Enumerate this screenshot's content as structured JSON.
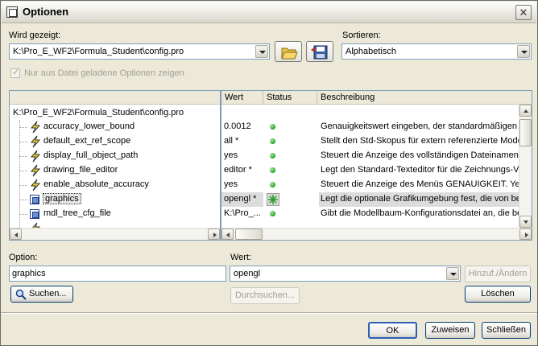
{
  "window": {
    "title": "Optionen",
    "close_glyph": "✕"
  },
  "top": {
    "shown_label": "Wird gezeigt:",
    "shown_value": "K:\\Pro_E_WF2\\Formula_Student\\config.pro",
    "sort_label": "Sortieren:",
    "sort_value": "Alphabetisch",
    "checkbox_label": "Nur aus Datei geladene Optionen zeigen"
  },
  "table": {
    "columns": {
      "wert": "Wert",
      "status": "Status",
      "beschreibung": "Beschreibung"
    },
    "root": "K:\\Pro_E_WF2\\Formula_Student\\config.pro",
    "rows": [
      {
        "name": "accuracy_lower_bound",
        "icon": "bolt-icon",
        "wert": "0.0012",
        "desc": "Genauigkeitswert eingeben, der standardmäßigen untere"
      },
      {
        "name": "default_ext_ref_scope",
        "icon": "bolt-icon",
        "wert": "all *",
        "desc": "Stellt den Std-Skopus für extern referenzierte Modelle"
      },
      {
        "name": "display_full_object_path",
        "icon": "bolt-icon",
        "wert": "yes",
        "desc": "Steuert die Anzeige des vollständigen Dateinamens"
      },
      {
        "name": "drawing_file_editor",
        "icon": "bolt-icon",
        "wert": "editor *",
        "desc": "Legt den Standard-Texteditor für die Zeichnungs-Vorlage"
      },
      {
        "name": "enable_absolute_accuracy",
        "icon": "bolt-icon",
        "wert": "yes",
        "desc": "Steuert die Anzeige des Menüs GENAUIGKEIT. Yes"
      },
      {
        "name": "graphics",
        "icon": "box-icon",
        "wert": "opengl *",
        "desc": "Legt die optionale Grafikumgebung fest, die von bes"
      },
      {
        "name": "mdl_tree_cfg_file",
        "icon": "box-icon",
        "wert": "K:\\Pro_...",
        "desc": "Gibt die Modellbaum-Konfigurationsdatei an, die beim"
      }
    ]
  },
  "bottom": {
    "option_label": "Option:",
    "option_value": "graphics",
    "wert_label": "Wert:",
    "wert_value": "opengl",
    "add_change": "Hinzuf./Ändern",
    "search": "Suchen...",
    "browse": "Durchsuchen...",
    "delete": "Löschen"
  },
  "footer": {
    "ok": "OK",
    "apply": "Zuweisen",
    "close": "Schließen"
  },
  "colors": {
    "status_ok": "#1f9a1f",
    "selected_star": "#2a9d2a"
  }
}
